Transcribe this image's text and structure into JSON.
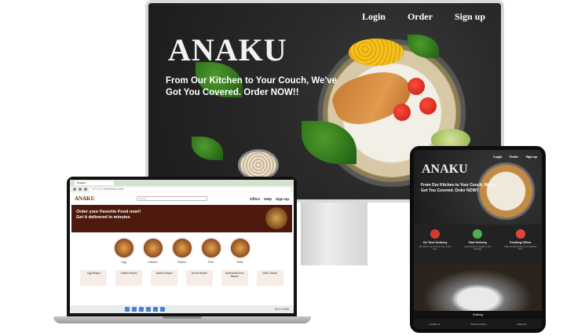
{
  "monitor": {
    "nav": [
      "Login",
      "Order",
      "Sign up"
    ],
    "brand": "ANAKU",
    "tagline": "From Our Kitchen to Your Couch, We've Got You Covered. Order NOW!!"
  },
  "laptop": {
    "tab_title": "Anaku",
    "url": "127.0.0.1:5500/index.html",
    "logo": "ANAKU",
    "search_placeholder": "Search",
    "links": [
      "Offers",
      "Help",
      "Sign Up"
    ],
    "banner_line1": "Order your Favorite Food now!!",
    "banner_line2": "Get it delivered in minutes",
    "categories": [
      "Egg",
      "Chicken",
      "Mutton",
      "Fish",
      "Rotis"
    ],
    "cards": [
      "Egg Biryani",
      "Mutton Biryani",
      "Andhra Biryani",
      "Donne Biryani",
      "Hyderabadi Dum Biryani",
      "Chilli Chicken"
    ],
    "clock": "20:12 11/06"
  },
  "tablet": {
    "nav": [
      "Login",
      "Order",
      "Sign up"
    ],
    "brand": "ANAKU",
    "tagline": "From Our Kitchen to Your Couch, We've Got You Covered. Order NOW!!",
    "features": [
      {
        "title": "On Time Delivery",
        "desc": "We deliver your food on time, every time.",
        "color": "#d33a2c"
      },
      {
        "title": "Fast Delivery",
        "desc": "Quick delivery straight to your doorstep.",
        "color": "#4caf50"
      },
      {
        "title": "Exciting Offers",
        "desc": "Grab the best deals on your favorite food.",
        "color": "#e0473a"
      }
    ],
    "section_heading": "Ordering",
    "footer": [
      "Contact Us",
      "Privacy & Terms",
      "Follow Us"
    ]
  }
}
